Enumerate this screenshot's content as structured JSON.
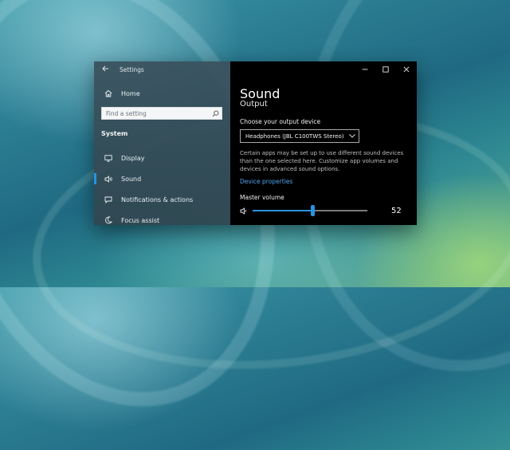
{
  "window": {
    "title": "Settings",
    "controls": [
      "minimize-icon",
      "maximize-icon",
      "close-icon"
    ]
  },
  "sidebar": {
    "home_label": "Home",
    "search_placeholder": "Find a setting",
    "section_label": "System",
    "items": [
      {
        "label": "Display",
        "icon": "display-icon",
        "active": false
      },
      {
        "label": "Sound",
        "icon": "speaker-icon",
        "active": true
      },
      {
        "label": "Notifications & actions",
        "icon": "notification-icon",
        "active": false
      },
      {
        "label": "Focus assist",
        "icon": "moon-icon",
        "active": false
      }
    ]
  },
  "sound": {
    "page_title": "Sound",
    "section_title": "Output",
    "device_label": "Choose your output device",
    "selected_device": "Headphones (JBL C100TWS Stereo)",
    "description": "Certain apps may be set up to use different sound devices than the one selected here. Customize app volumes and devices in advanced sound options.",
    "device_properties_link": "Device properties",
    "master_volume_label": "Master volume",
    "volume_value": "52",
    "volume_percent": 52
  },
  "colors": {
    "accent": "#2a93e0",
    "link": "#4ea3ef"
  }
}
